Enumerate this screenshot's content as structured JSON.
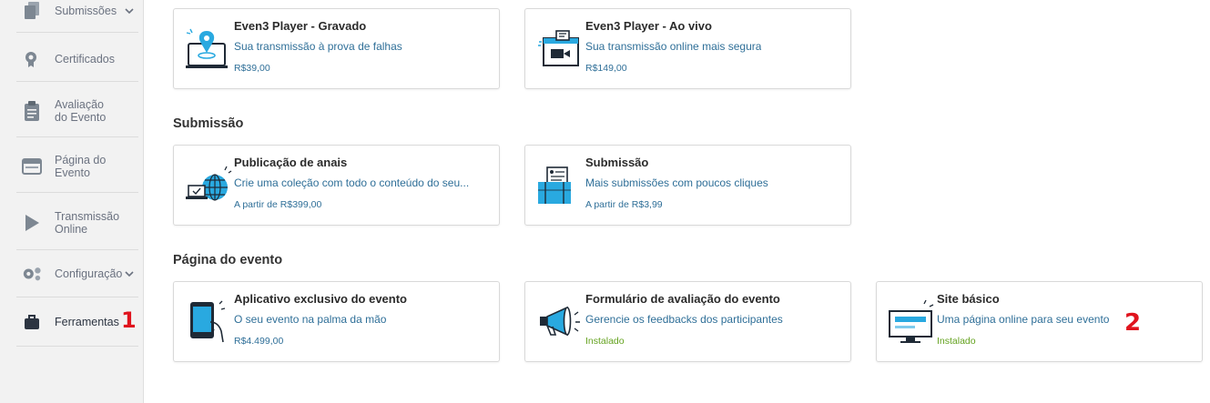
{
  "sidebar": {
    "items": [
      {
        "label": "Submissões"
      },
      {
        "label": "Certificados"
      },
      {
        "label_line1": "Avaliação",
        "label_line2": "do Evento"
      },
      {
        "label_line1": "Página do",
        "label_line2": "Evento"
      },
      {
        "label_line1": "Transmissão",
        "label_line2": "Online"
      },
      {
        "label": "Configuração"
      },
      {
        "label": "Ferramentas"
      }
    ]
  },
  "markers": {
    "one": "1",
    "two": "2"
  },
  "sections": {
    "streaming": {
      "cards": [
        {
          "title": "Even3 Player - Gravado",
          "description": "Sua transmissão à prova de falhas",
          "price": "R$39,00"
        },
        {
          "title": "Even3 Player - Ao vivo",
          "description": "Sua transmissão online mais segura",
          "price": "R$149,00"
        }
      ]
    },
    "submissao": {
      "title": "Submissão",
      "cards": [
        {
          "title": "Publicação de anais",
          "description": "Crie uma coleção com todo o conteúdo do seu...",
          "price": "A partir de R$399,00"
        },
        {
          "title": "Submissão",
          "description": "Mais submissões com poucos cliques",
          "price": "A partir de R$3,99"
        }
      ]
    },
    "pagina": {
      "title": "Página do evento",
      "cards": [
        {
          "title": "Aplicativo exclusivo do evento",
          "description": "O seu evento na palma da mão",
          "price": "R$4.499,00"
        },
        {
          "title": "Formulário de avaliação do evento",
          "description": "Gerencie os feedbacks dos participantes",
          "price": "Instalado"
        },
        {
          "title": "Site básico",
          "description": "Uma página online para seu evento",
          "price": "Instalado"
        }
      ]
    }
  },
  "colors": {
    "accent_blue": "#2f6f98",
    "installed_green": "#64a21f",
    "marker_red": "#e0141e",
    "icon_cyan": "#29a9e0"
  }
}
